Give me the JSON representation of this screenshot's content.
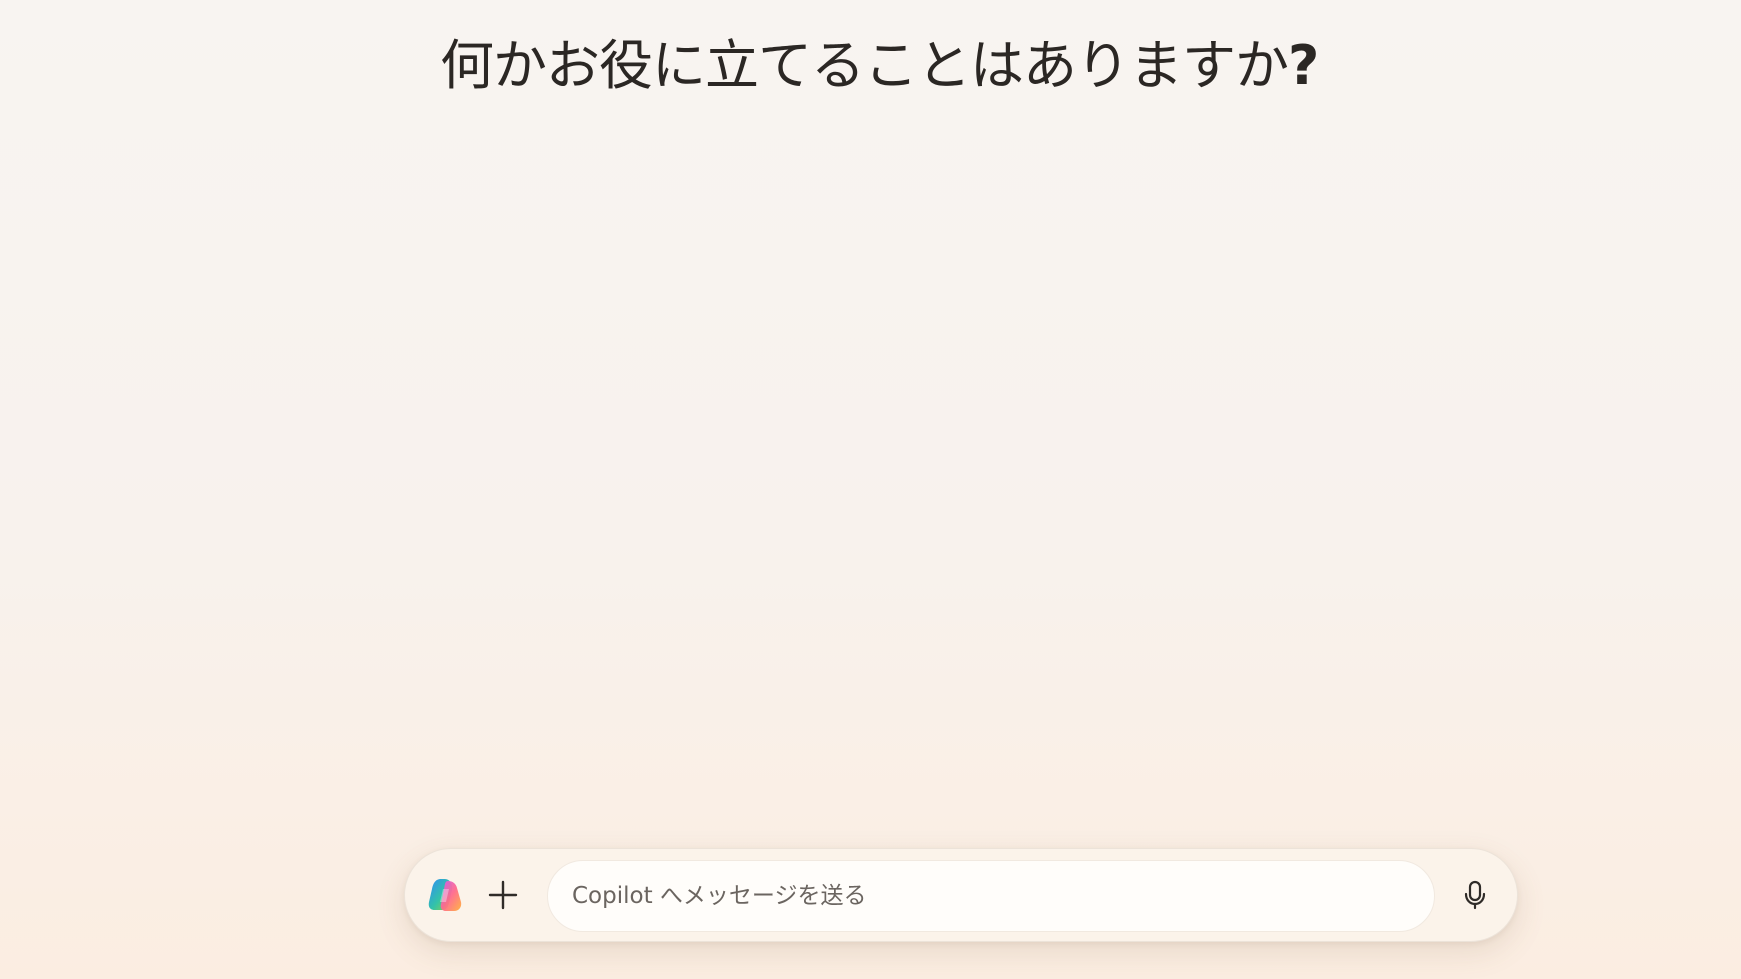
{
  "main": {
    "greeting": "何かお役に立てることはありますか",
    "greeting_mark": "?"
  },
  "composer": {
    "placeholder": "Copilot へメッセージを送る",
    "logo_icon": "copilot-logo-icon",
    "add_icon": "plus-icon",
    "mic_icon": "microphone-icon"
  },
  "colors": {
    "background_top": "#f8f4f1",
    "background_bottom": "#fbede1",
    "composer_bg": "#fbf3ea",
    "input_bg": "#fffdfa",
    "text": "#2b2724"
  }
}
